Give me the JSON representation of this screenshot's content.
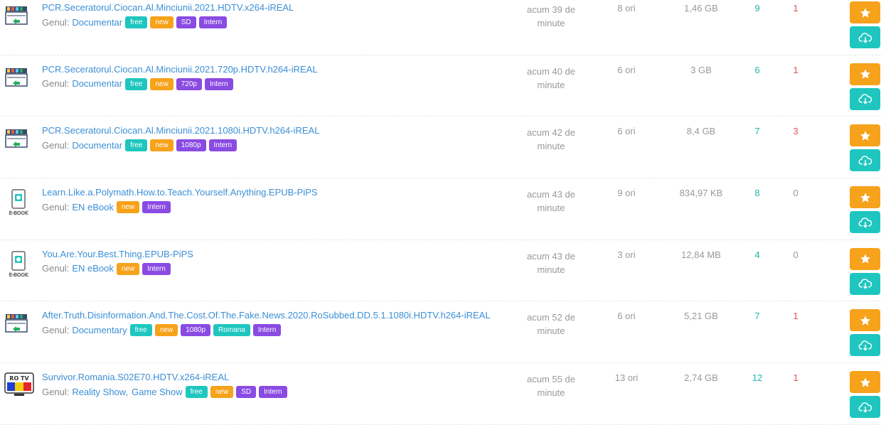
{
  "genre_label": "Genul:",
  "rows": [
    {
      "icon": "tv-hd-category-icon",
      "title": "PCR.Seceratorul.Ciocan.Al.Minciunii.2021.HDTV.x264-iREAL",
      "genres": [
        "Documentar"
      ],
      "tags": [
        {
          "text": "free",
          "kind": "free"
        },
        {
          "text": "new",
          "kind": "new"
        },
        {
          "text": "SD",
          "kind": "q"
        },
        {
          "text": "Intern",
          "kind": "intern"
        }
      ],
      "added_line1": "acum 39 de",
      "added_line2": "minute",
      "snatched": "8 ori",
      "size": "1,46 GB",
      "seeders": "9",
      "leechers": "1"
    },
    {
      "icon": "tv-hd-category-icon",
      "title": "PCR.Seceratorul.Ciocan.Al.Minciunii.2021.720p.HDTV.h264-iREAL",
      "genres": [
        "Documentar"
      ],
      "tags": [
        {
          "text": "free",
          "kind": "free"
        },
        {
          "text": "new",
          "kind": "new"
        },
        {
          "text": "720p",
          "kind": "q"
        },
        {
          "text": "Intern",
          "kind": "intern"
        }
      ],
      "added_line1": "acum 40 de",
      "added_line2": "minute",
      "snatched": "6 ori",
      "size": "3 GB",
      "seeders": "6",
      "leechers": "1"
    },
    {
      "icon": "tv-hd-category-icon",
      "title": "PCR.Seceratorul.Ciocan.Al.Minciunii.2021.1080i.HDTV.h264-iREAL",
      "genres": [
        "Documentar"
      ],
      "tags": [
        {
          "text": "free",
          "kind": "free"
        },
        {
          "text": "new",
          "kind": "new"
        },
        {
          "text": "1080p",
          "kind": "q"
        },
        {
          "text": "Intern",
          "kind": "intern"
        }
      ],
      "added_line1": "acum 42 de",
      "added_line2": "minute",
      "snatched": "6 ori",
      "size": "8,4 GB",
      "seeders": "7",
      "leechers": "3"
    },
    {
      "icon": "ebook-category-icon",
      "title": "Learn.Like.a.Polymath.How.to.Teach.Yourself.Anything.EPUB-PiPS",
      "genres": [
        "EN eBook"
      ],
      "tags": [
        {
          "text": "new",
          "kind": "new"
        },
        {
          "text": "Intern",
          "kind": "intern"
        }
      ],
      "added_line1": "acum 43 de",
      "added_line2": "minute",
      "snatched": "9 ori",
      "size": "834,97 KB",
      "seeders": "8",
      "leechers": "0"
    },
    {
      "icon": "ebook-category-icon",
      "title": "You.Are.Your.Best.Thing.EPUB-PiPS",
      "genres": [
        "EN eBook"
      ],
      "tags": [
        {
          "text": "new",
          "kind": "new"
        },
        {
          "text": "Intern",
          "kind": "intern"
        }
      ],
      "added_line1": "acum 43 de",
      "added_line2": "minute",
      "snatched": "3 ori",
      "size": "12,84 MB",
      "seeders": "4",
      "leechers": "0"
    },
    {
      "icon": "tv-hd-category-icon",
      "title": "After.Truth.Disinformation.And.The.Cost.Of.The.Fake.News.2020.RoSubbed.DD.5.1.1080i.HDTV.h264-iREAL",
      "genres": [
        "Documentary"
      ],
      "tags": [
        {
          "text": "free",
          "kind": "free"
        },
        {
          "text": "new",
          "kind": "new"
        },
        {
          "text": "1080p",
          "kind": "q"
        },
        {
          "text": "Romana",
          "kind": "romana"
        },
        {
          "text": "Intern",
          "kind": "intern"
        }
      ],
      "added_line1": "acum 52 de",
      "added_line2": "minute",
      "snatched": "6 ori",
      "size": "5,21 GB",
      "seeders": "7",
      "leechers": "1"
    },
    {
      "icon": "ro-tv-category-icon",
      "title": "Survivor.Romania.S02E70.HDTV.x264-iREAL",
      "genres": [
        "Reality Show",
        "Game Show"
      ],
      "tags": [
        {
          "text": "free",
          "kind": "free"
        },
        {
          "text": "new",
          "kind": "new"
        },
        {
          "text": "SD",
          "kind": "q"
        },
        {
          "text": "Intern",
          "kind": "intern"
        }
      ],
      "added_line1": "acum 55 de",
      "added_line2": "minute",
      "snatched": "13 ori",
      "size": "2,74 GB",
      "seeders": "12",
      "leechers": "1"
    }
  ]
}
